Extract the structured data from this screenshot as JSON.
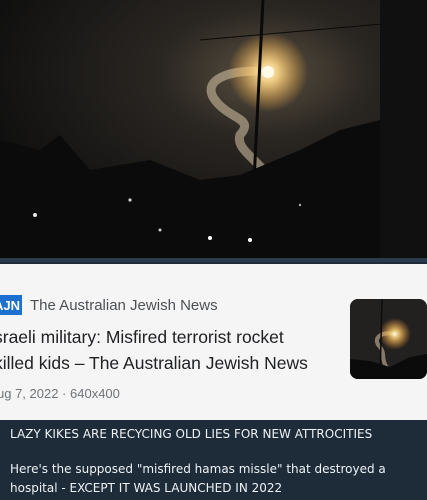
{
  "result_card": {
    "site_logo": "AJN",
    "site_name": "The Australian Jewish News",
    "headline_line1": "sraeli military: Misfired terrorist rocket",
    "headline_line2": "killed kids – The Australian Jewish News",
    "meta": "ug 7, 2022 · 640x400"
  },
  "post": {
    "line1": "LAZY KIKES ARE RECYCING OLD LIES FOR NEW ATTROCITIES",
    "line2": "Here's the supposed \"misfired hamas missle\" that destroyed a",
    "line3": "hospital - EXCEPT IT WAS LAUNCHED IN 2022"
  }
}
